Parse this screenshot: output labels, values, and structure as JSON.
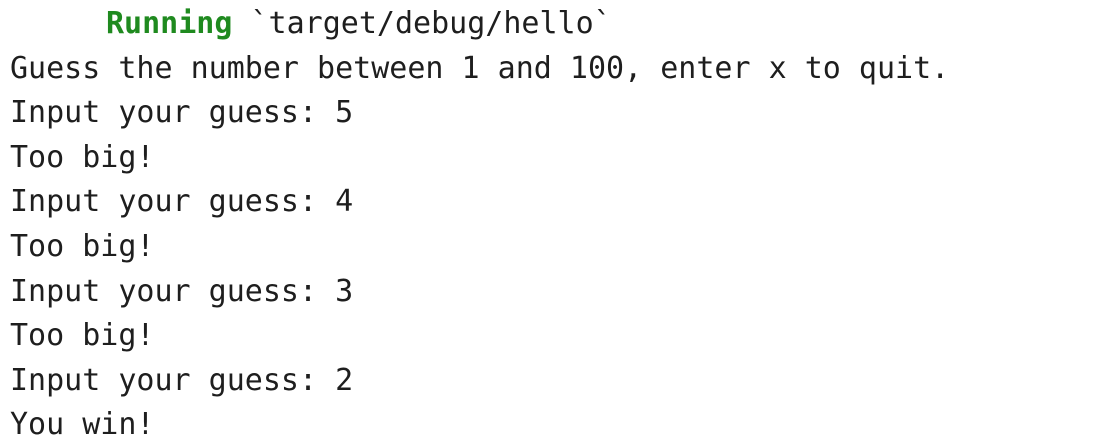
{
  "terminal": {
    "status": {
      "word": "Running",
      "target": "`target/debug/hello`"
    },
    "lines": [
      "Guess the number between 1 and 100, enter x to quit.",
      "Input your guess: 5",
      "Too big!",
      "Input your guess: 4",
      "Too big!",
      "Input your guess: 3",
      "Too big!",
      "Input your guess: 2",
      "You win!"
    ],
    "colors": {
      "status_word": "#1f8a1f",
      "text": "#1e1e1e",
      "background": "#ffffff"
    }
  }
}
